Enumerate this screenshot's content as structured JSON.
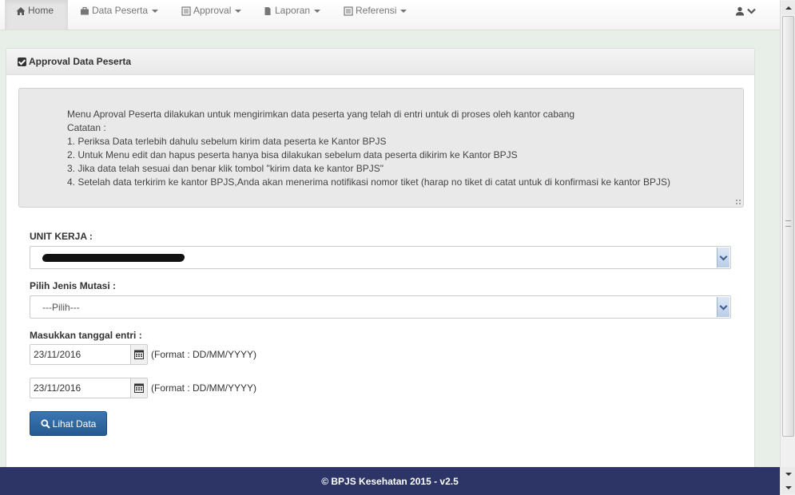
{
  "navbar": {
    "items": [
      {
        "label": "Home",
        "icon": "home-icon",
        "active": true
      },
      {
        "label": "Data Peserta",
        "icon": "briefcase-icon",
        "active": false
      },
      {
        "label": "Approval",
        "icon": "list-alt-icon",
        "active": false
      },
      {
        "label": "Laporan",
        "icon": "file-icon",
        "active": false
      },
      {
        "label": "Referensi",
        "icon": "list-alt-icon",
        "active": false
      }
    ],
    "user_icon": "user-icon"
  },
  "panel": {
    "title": "Approval Data Peserta",
    "info_lines": [
      "Menu Aproval Peserta dilakukan untuk mengirimkan data peserta yang telah di entri untuk di proses oleh kantor cabang",
      "Catatan :",
      "1. Periksa Data terlebih dahulu sebelum kirim data peserta ke Kantor BPJS",
      "2. Untuk Menu edit dan hapus peserta hanya bisa dilakukan sebelum data peserta dikirim ke Kantor BPJS",
      "3. Jika data telah sesuai dan benar klik tombol \"kirim data ke kantor BPJS\"",
      "4. Setelah data terkirim ke kantor BPJS,Anda akan menerima notifikasi nomor tiket (harap no tiket di catat untuk di konfirmasi ke kantor BPJS)"
    ]
  },
  "form": {
    "unit_kerja_label": "UNIT KERJA :",
    "jenis_mutasi_label": "Pilih Jenis Mutasi :",
    "jenis_mutasi_value": "---Pilih---",
    "tanggal_label": "Masukkan tanggal entri :",
    "date_from": "23/11/2016",
    "date_to": "23/11/2016",
    "format_hint": "(Format : DD/MM/YYYY)",
    "submit_label": "Lihat Data"
  },
  "footer": {
    "text": "© BPJS Kesehatan 2015 - v2.5"
  },
  "colors": {
    "footer_bg": "#2c3566",
    "primary_button": "#2f6aa5"
  }
}
